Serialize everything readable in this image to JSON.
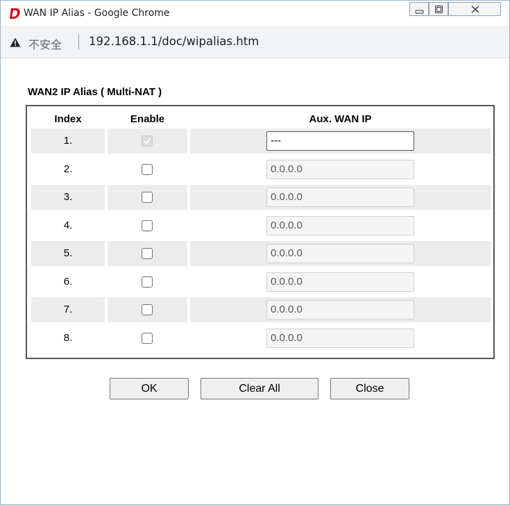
{
  "window": {
    "title": "WAN IP Alias - Google Chrome",
    "minimize_icon": "minimize-icon",
    "maximize_icon": "maximize-icon",
    "close_icon": "close-icon"
  },
  "address_bar": {
    "security_label": "不安全",
    "url": "192.168.1.1/doc/wipalias.htm"
  },
  "section": {
    "title": "WAN2  IP Alias ( Multi-NAT )"
  },
  "table": {
    "headers": {
      "index": "Index",
      "enable": "Enable",
      "ip": "Aux. WAN IP"
    },
    "rows": [
      {
        "index": "1.",
        "enabled": true,
        "ip": "---",
        "checkbox_disabled": true
      },
      {
        "index": "2.",
        "enabled": false,
        "ip": "0.0.0.0",
        "checkbox_disabled": false
      },
      {
        "index": "3.",
        "enabled": false,
        "ip": "0.0.0.0",
        "checkbox_disabled": false
      },
      {
        "index": "4.",
        "enabled": false,
        "ip": "0.0.0.0",
        "checkbox_disabled": false
      },
      {
        "index": "5.",
        "enabled": false,
        "ip": "0.0.0.0",
        "checkbox_disabled": false
      },
      {
        "index": "6.",
        "enabled": false,
        "ip": "0.0.0.0",
        "checkbox_disabled": false
      },
      {
        "index": "7.",
        "enabled": false,
        "ip": "0.0.0.0",
        "checkbox_disabled": false
      },
      {
        "index": "8.",
        "enabled": false,
        "ip": "0.0.0.0",
        "checkbox_disabled": false
      }
    ]
  },
  "buttons": {
    "ok": "OK",
    "clear_all": "Clear All",
    "close": "Close"
  },
  "colors": {
    "logo_red": "#d0021b",
    "frame_border": "#555555",
    "row_shade": "#ececec"
  }
}
